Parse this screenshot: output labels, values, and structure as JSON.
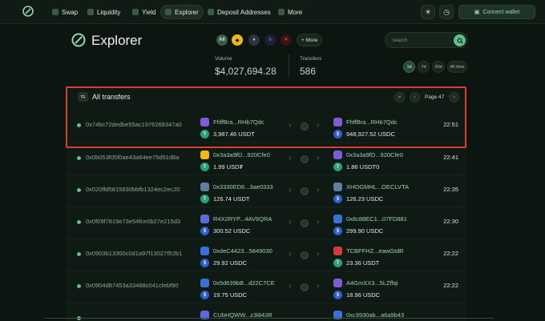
{
  "nav": {
    "items": [
      {
        "label": "Swap",
        "icon": "swap-icon",
        "active": false
      },
      {
        "label": "Liquidity",
        "icon": "liquidity-icon",
        "active": false
      },
      {
        "label": "Yield",
        "icon": "yield-icon",
        "active": false
      },
      {
        "label": "Explorer",
        "icon": "explorer-icon",
        "active": true
      },
      {
        "label": "Deposit Addresses",
        "icon": "deposit-icon",
        "active": false
      },
      {
        "label": "More",
        "icon": "grid-icon",
        "active": false
      }
    ],
    "connect_label": "Connect wallet"
  },
  "explorer": {
    "title": "Explorer",
    "chain_all": "All",
    "more_label": "+ More",
    "search_placeholder": "Search",
    "volume_label": "Volume",
    "volume_value": "$4,027,694.28",
    "transfers_label": "Transfers",
    "transfers_value": "586",
    "ranges": [
      "1d",
      "7d",
      "30d",
      "All time"
    ],
    "active_range": "1d"
  },
  "panel": {
    "title": "All transfers",
    "page_label": "Page 47"
  },
  "rows": [
    {
      "hash": "0x74bc72dedbe55ac1976268347a0",
      "from_addr": "FhffBra...RHb7Qdc",
      "from_amt": "3,987.46 USDT",
      "to_addr": "FhffBra...RHb7Qdc",
      "to_amt": "948,927.52 USDC",
      "time": "22:51"
    },
    {
      "hash": "0x0b053f05f0ae43a64ee75d51d8a",
      "from_addr": "0x3a3a9fD...920Cfe0",
      "from_amt": "1.99 USD₮",
      "to_addr": "0x3a3a9fD...920Cfe0",
      "to_amt": "1.86 USDT0",
      "time": "22:41"
    },
    {
      "hash": "0x020ffd5815830bbfb1324ec2ec20",
      "from_addr": "0x3330ED6...3ae0333",
      "from_amt": "126.74 USDT",
      "to_addr": "XHOGMHL...OECLVTA",
      "to_amt": "126.23 USDC",
      "time": "22:35"
    },
    {
      "hash": "0x0f09f7819e73e54fce0b27e215d3",
      "from_addr": "R4X2RYP...4AV6QRA",
      "from_amt": "300.52 USDC",
      "to_addr": "0x8c88EC1...07FD881",
      "to_amt": "299.90 USDC",
      "time": "22:30"
    },
    {
      "hash": "0x0903b13300c0d1a97f13027f52b1",
      "from_addr": "0xdeC4423...5849030",
      "from_amt": "29.92 USDC",
      "to_addr": "TCBFFHZ...eawGtdR",
      "to_amt": "23.36 USDT",
      "time": "22:22"
    },
    {
      "hash": "0x0904d87453a33488c041cfebf90",
      "from_addr": "0x5d639bB...d22C7CE",
      "from_amt": "19.75 USDC",
      "to_addr": "A4GmXX3...5LZffqi",
      "to_amt": "18.96 USDC",
      "time": "22:22"
    },
    {
      "hash": "",
      "from_addr": "CUbHQWW...z3i843R",
      "from_amt": "",
      "to_addr": "0xc3930ab...a6a9b43",
      "to_amt": "",
      "time": ""
    }
  ],
  "colors": {
    "accent": "#5fbf8c",
    "highlight": "#d8412f",
    "background": "#0c1510"
  }
}
